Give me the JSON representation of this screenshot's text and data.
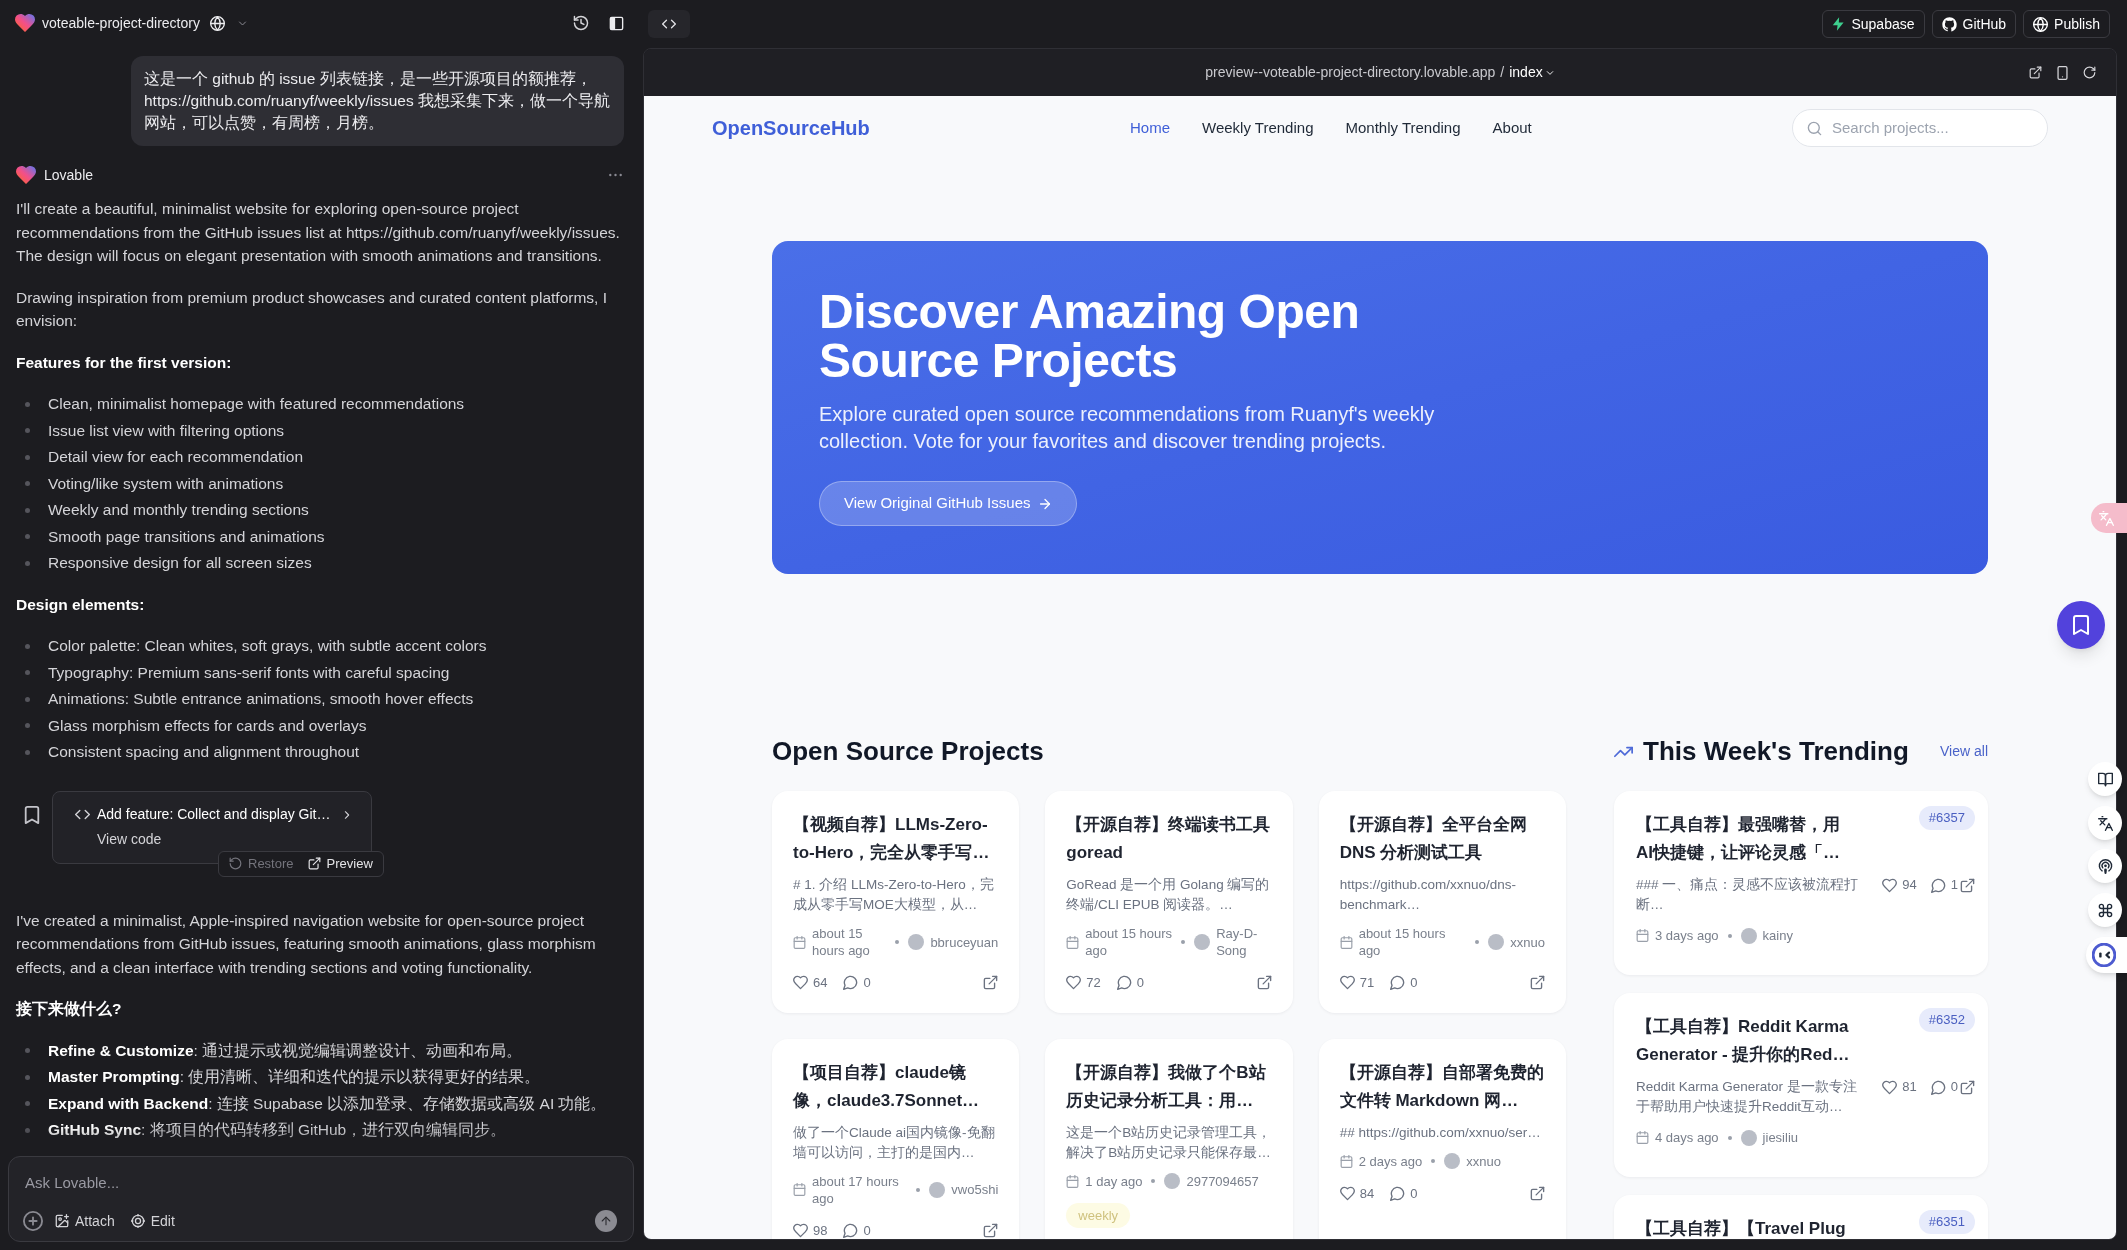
{
  "app": {
    "project_name": "voteable-project-directory"
  },
  "chat": {
    "user_message": "这是一个 github 的 issue 列表链接，是一些开源项目的额推荐，https://github.com/ruanyf/weekly/issues 我想采集下来，做一个导航网站，可以点赞，有周榜，月榜。",
    "assistant_name": "Lovable",
    "blocks": [
      {
        "kind": "paragraph",
        "text": "I'll create a beautiful, minimalist website for exploring open-source project recommendations from the GitHub issues list at https://github.com/ruanyf/weekly/issues. The design will focus on elegant presentation with smooth animations and transitions."
      },
      {
        "kind": "paragraph",
        "text": "Drawing inspiration from premium product showcases and curated content platforms, I envision:"
      },
      {
        "kind": "heading",
        "text": "Features for the first version:"
      },
      {
        "kind": "list",
        "items": [
          "Clean, minimalist homepage with featured recommendations",
          "Issue list view with filtering options",
          "Detail view for each recommendation",
          "Voting/like system with animations",
          "Weekly and monthly trending sections",
          "Smooth page transitions and animations",
          "Responsive design for all screen sizes"
        ]
      },
      {
        "kind": "heading",
        "text": "Design elements:"
      },
      {
        "kind": "list",
        "items": [
          "Color palette: Clean whites, soft grays, with subtle accent colors",
          "Typography: Premium sans-serif fonts with careful spacing",
          "Animations: Subtle entrance animations, smooth hover effects",
          "Glass morphism effects for cards and overlays",
          "Consistent spacing and alignment throughout"
        ]
      },
      {
        "kind": "commit",
        "title": "Add feature: Collect and display Git…",
        "link": "View code",
        "actions": [
          {
            "kind": "restore",
            "label": "Restore",
            "disabled": true
          },
          {
            "kind": "preview",
            "label": "Preview",
            "disabled": false
          }
        ]
      },
      {
        "kind": "paragraph",
        "text": "I've created a minimalist, Apple-inspired navigation website for open-source project recommendations from GitHub issues, featuring smooth animations, glass morphism effects, and a clean interface with trending sections and voting functionality."
      },
      {
        "kind": "heading",
        "text": "接下来做什么?"
      },
      {
        "kind": "list",
        "items": [
          "**Refine & Customize**: 通过提示或视觉编辑调整设计、动画和布局。",
          "**Master Prompting**: 使用清晰、详细和迭代的提示以获得更好的结果。",
          "**Expand with Backend**: 连接 Supabase 以添加登录、存储数据或高级 AI 功能。",
          "**GitHub Sync**: 将项目的代码转移到 GitHub，进行双向编辑同步。"
        ]
      }
    ]
  },
  "composer": {
    "placeholder": "Ask Lovable...",
    "actions": [
      {
        "kind": "attach",
        "label": "Attach"
      },
      {
        "kind": "edit",
        "label": "Edit"
      }
    ]
  },
  "top_bar": {
    "buttons": [
      {
        "kind": "supabase",
        "label": "Supabase"
      },
      {
        "kind": "github",
        "label": "GitHub"
      },
      {
        "kind": "publish",
        "label": "Publish"
      }
    ]
  },
  "preview": {
    "url": "preview--voteable-project-directory.lovable.app",
    "separator": "/",
    "route": "index"
  },
  "site": {
    "logo": "OpenSourceHub",
    "nav": [
      {
        "label": "Home",
        "selected": true
      },
      {
        "label": "Weekly Trending",
        "selected": false
      },
      {
        "label": "Monthly Trending",
        "selected": false
      },
      {
        "label": "About",
        "selected": false
      }
    ],
    "search": {
      "placeholder": "Search projects..."
    },
    "hero": {
      "title": "Discover Amazing Open Source Projects",
      "subtitle": "Explore curated open source recommendations from Ruanyf's weekly collection. Vote for your favorites and discover trending projects.",
      "button": "View Original GitHub Issues"
    },
    "projects": {
      "title": "Open Source Projects",
      "cards": [
        {
          "title": "【视频自荐】LLMs-Zero-to-Hero，完全从零手写…",
          "description": "# 1. 介绍 LLMs-Zero-to-Hero，完成从零手写MOE大模型，从…",
          "time": "about 15 hours ago",
          "author": "bbruceyuan",
          "likes": "64",
          "comments": "0"
        },
        {
          "title": "【开源自荐】终端读书工具 goread",
          "description": "GoRead 是一个用 Golang 编写的终端/CLI EPUB 阅读器。…",
          "time": "about 15 hours ago",
          "author": "Ray-D-Song",
          "likes": "72",
          "comments": "0"
        },
        {
          "title": "【开源自荐】全平台全网 DNS 分析测试工具",
          "description": "https://github.com/xxnuo/dns-benchmark…",
          "time": "about 15 hours ago",
          "author": "xxnuo",
          "likes": "71",
          "comments": "0"
        },
        {
          "title": "【项目自荐】claude镜像，claude3.7Sonnet…",
          "description": "做了一个Claude ai国内镜像-免翻墙可以访问，主打的是国内…",
          "time": "about 17 hours ago",
          "author": "vwo5shi",
          "likes": "98",
          "comments": "0"
        },
        {
          "title": "【开源自荐】我做了个B站历史记录分析工具：用…",
          "description": "这是一个B站历史记录管理工具，解决了B站历史记录只能保存最…",
          "time": "1 day ago",
          "author": "2977094657",
          "tags": [
            "weekly"
          ]
        },
        {
          "title": "【开源自荐】自部署免费的文件转 Markdown 网…",
          "description": "## https://github.com/xxnuo/ser…",
          "time": "2 days ago",
          "author": "xxnuo",
          "likes": "84",
          "comments": "0"
        }
      ]
    },
    "trending": {
      "title": "This Week's Trending",
      "link": "View all",
      "cards": [
        {
          "number": "#6357",
          "title": "【工具自荐】最强嘴替，用AI快捷键，让评论灵感「…",
          "description": "### 一、痛点：灵感不应该被流程打断…",
          "likes": "94",
          "comments": "1",
          "time": "3 days ago",
          "author": "kainy"
        },
        {
          "number": "#6352",
          "title": "【工具自荐】Reddit Karma Generator - 提升你的Red…",
          "description": "Reddit Karma Generator 是一款专注于帮助用户快速提升Reddit互动…",
          "likes": "81",
          "comments": "0",
          "time": "4 days ago",
          "author": "jiesiliu"
        },
        {
          "number": "#6351",
          "title": "【工具自荐】【Travel Plug"
        }
      ]
    }
  }
}
